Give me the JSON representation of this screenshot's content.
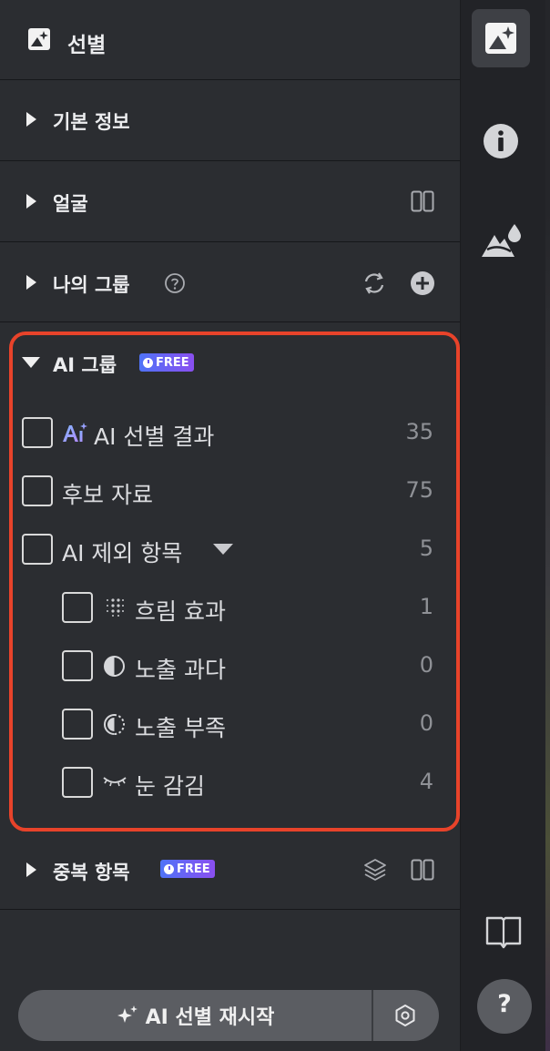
{
  "header": {
    "title": "선별",
    "icon": "image-sparkle-icon"
  },
  "sections": {
    "basic_info": {
      "label": "기본 정보"
    },
    "face": {
      "label": "얼굴",
      "action_icon": "split-view-icon"
    },
    "my_groups": {
      "label": "나의 그룹",
      "help_icon": "help-circle-icon",
      "actions": [
        "refresh-icon",
        "add-circle-icon"
      ]
    },
    "ai_groups": {
      "label": "AI 그룹",
      "badge": "FREE",
      "items": [
        {
          "label": "AI 선별 결과",
          "count": "35",
          "icon": "ai-sparkle-icon"
        },
        {
          "label": "후보 자료",
          "count": "75"
        },
        {
          "label": "AI 제외 항목",
          "count": "5",
          "expanded": true
        },
        {
          "label": "흐림 효과",
          "count": "1",
          "icon": "blur-dots-icon"
        },
        {
          "label": "노출 과다",
          "count": "0",
          "icon": "overexposure-icon"
        },
        {
          "label": "노출 부족",
          "count": "0",
          "icon": "underexposure-icon"
        },
        {
          "label": "눈 감김",
          "count": "4",
          "icon": "closed-eye-icon"
        }
      ]
    },
    "duplicates": {
      "label": "중복 항목",
      "badge": "FREE",
      "actions": [
        "layers-icon",
        "split-view-icon"
      ]
    }
  },
  "footer": {
    "restart_label": "AI 선별 재시작",
    "settings_icon": "hexagon-settings-icon"
  },
  "rail": {
    "items": [
      "image-sparkle-icon",
      "info-icon",
      "landscape-drop-icon",
      "book-icon",
      "help-icon"
    ]
  },
  "colors": {
    "highlight_border": "#e8432a",
    "badge_start": "#4f73f7",
    "badge_end": "#8a4ff0"
  }
}
